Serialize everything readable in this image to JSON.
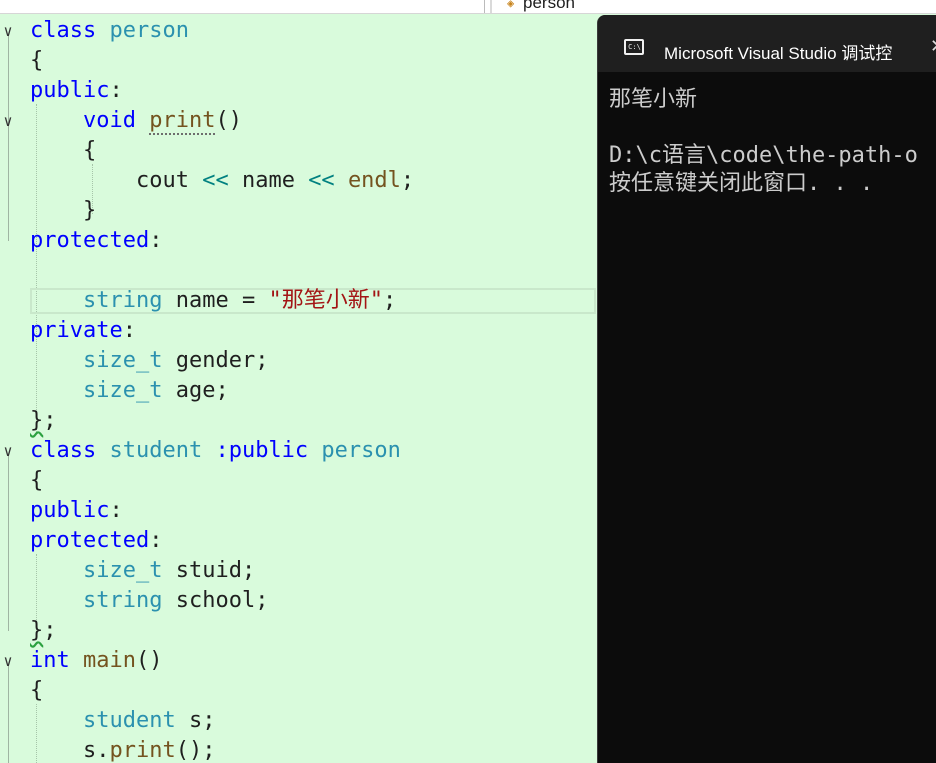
{
  "navbar": {
    "symbol_icon": "class-symbol-icon",
    "symbol_name": "person"
  },
  "editor": {
    "cls1": {
      "kw": "class",
      "name": "person"
    },
    "brace_open": "{",
    "brace_close": "}",
    "brace_close_semi": "}",
    "semi": ";",
    "access_public": "public",
    "access_protected": "protected",
    "access_private": "private",
    "colon": ":",
    "print_fn": {
      "type": "void",
      "name": "print",
      "parens": "()"
    },
    "cout_line": {
      "obj": "cout",
      "op": "<<",
      "var": "name",
      "endl": "endl"
    },
    "name_decl": {
      "type": "string",
      "name": "name",
      "eq": "=",
      "value": "\"那笔小新\""
    },
    "gender_decl": {
      "type": "size_t",
      "name": "gender"
    },
    "age_decl": {
      "type": "size_t",
      "name": "age"
    },
    "cls2": {
      "kw": "class",
      "name": "student",
      "inherit_kw": ":public",
      "base": "person"
    },
    "stuid_decl": {
      "type": "size_t",
      "name": "stuid"
    },
    "school_decl": {
      "type": "string",
      "name": "school"
    },
    "main_fn": {
      "type": "int",
      "name": "main",
      "parens": "()"
    },
    "obj_decl": {
      "type": "student",
      "name": "s"
    },
    "call": {
      "obj": "s",
      "dot": ".",
      "fn": "print",
      "parens": "()"
    }
  },
  "console": {
    "icon": "console-icon",
    "icon_text": "C:\\",
    "title": "Microsoft Visual Studio 调试控",
    "close_icon": "close-icon",
    "close_glyph": "✕",
    "output_lines": [
      "那笔小新",
      "",
      "D:\\c语言\\code\\the-path-o",
      "按任意键关闭此窗口. . ."
    ]
  },
  "colors": {
    "editor_bg": "#d9fbdc",
    "keyword": "#0000ff",
    "type": "#2b91af",
    "function": "#74531f",
    "string": "#a31515",
    "console_bg": "#0c0c0c"
  }
}
